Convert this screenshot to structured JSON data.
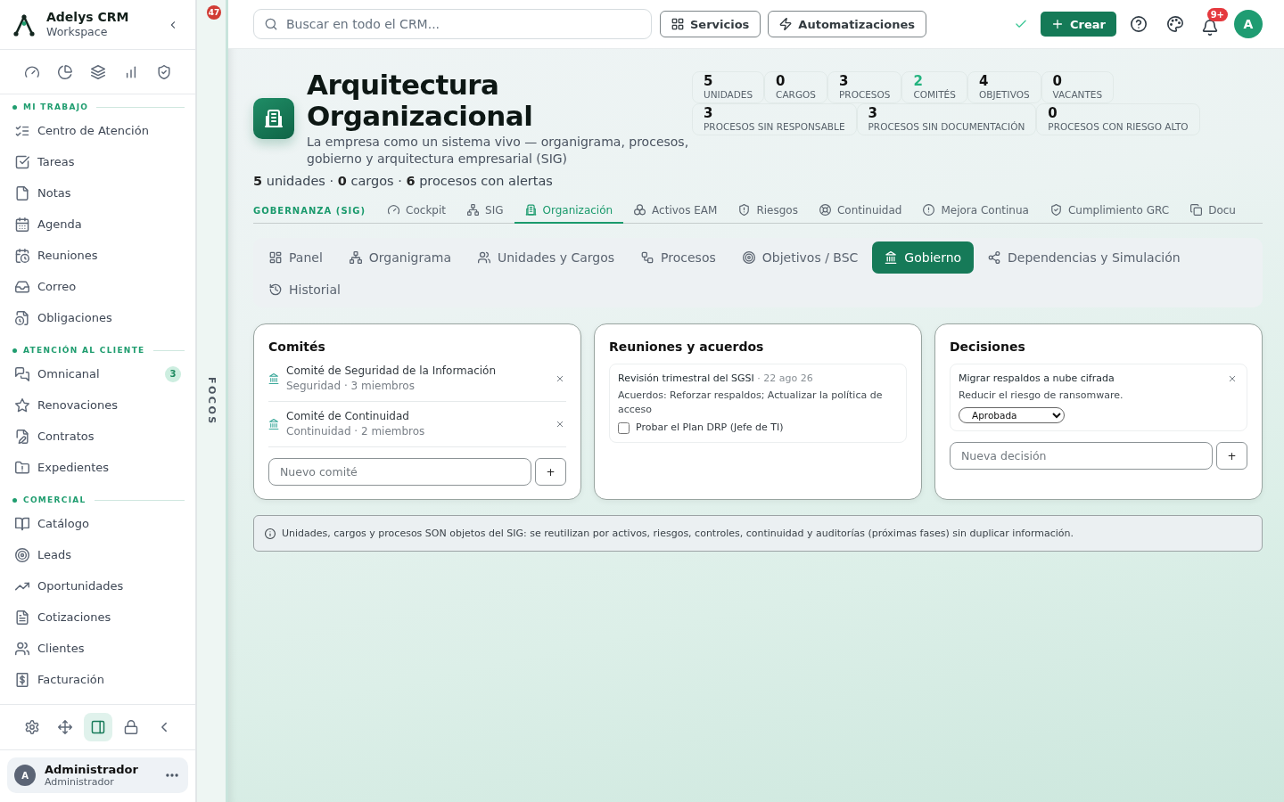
{
  "sidebar": {
    "brand": {
      "name": "Adelys CRM",
      "subtitle": "Workspace"
    },
    "sections": [
      {
        "title": "MI TRABAJO",
        "items": [
          {
            "label": "Centro de Atención"
          },
          {
            "label": "Tareas"
          },
          {
            "label": "Notas"
          },
          {
            "label": "Agenda"
          },
          {
            "label": "Reuniones"
          },
          {
            "label": "Correo"
          },
          {
            "label": "Obligaciones"
          }
        ]
      },
      {
        "title": "ATENCIÓN AL CLIENTE",
        "items": [
          {
            "label": "Omnicanal",
            "badge": "3"
          },
          {
            "label": "Renovaciones"
          },
          {
            "label": "Contratos"
          },
          {
            "label": "Expedientes"
          }
        ]
      },
      {
        "title": "COMERCIAL",
        "items": [
          {
            "label": "Catálogo"
          },
          {
            "label": "Leads"
          },
          {
            "label": "Oportunidades"
          },
          {
            "label": "Cotizaciones"
          },
          {
            "label": "Clientes"
          },
          {
            "label": "Facturación"
          }
        ]
      }
    ],
    "footer_tools": [
      {
        "selected": false
      },
      {
        "selected": false
      },
      {
        "selected": true
      },
      {
        "selected": false
      },
      {
        "selected": false
      }
    ],
    "user": {
      "initial": "A",
      "name": "Administrador",
      "role": "Administrador"
    }
  },
  "focus_rail": {
    "badge": "47",
    "label": "FOCOS"
  },
  "topbar": {
    "search": {
      "placeholder": "Buscar en todo el CRM..."
    },
    "buttons": [
      "Servicios",
      "Automatizaciones"
    ],
    "create_label": "Crear",
    "notifications": "9+",
    "avatar": "A"
  },
  "header": {
    "title": "Arquitectura Organizacional",
    "description": "La empresa como un sistema vivo — organigrama, procesos, gobierno y arquitectura empresarial (SIG)",
    "summary": "**5** unidades · **0** cargos · **6** procesos con alertas",
    "stats": [
      {
        "value": "5",
        "label": "UNIDADES",
        "highlighted": false
      },
      {
        "value": "0",
        "label": "CARGOS",
        "highlighted": false
      },
      {
        "value": "3",
        "label": "PROCESOS",
        "highlighted": false
      },
      {
        "value": "2",
        "label": "COMITÉS",
        "highlighted": true
      },
      {
        "value": "4",
        "label": "OBJETIVOS",
        "highlighted": false
      },
      {
        "value": "0",
        "label": "VACANTES",
        "highlighted": false
      }
    ],
    "alert_stats": [
      {
        "value": "3",
        "label": "PROCESOS SIN RESPONSABLE",
        "highlighted": false
      },
      {
        "value": "3",
        "label": "PROCESOS SIN DOCUMENTACIÓN",
        "highlighted": false
      },
      {
        "value": "0",
        "label": "PROCESOS CON RIESGO ALTO",
        "highlighted": false
      }
    ]
  },
  "module_nav": {
    "section_label": "GOBERNANZA (SIG)",
    "tabs": [
      {
        "label": "Cockpit",
        "selected": false
      },
      {
        "label": "SIG",
        "selected": false
      },
      {
        "label": "Organización",
        "selected": true
      },
      {
        "label": "Activos EAM",
        "selected": false
      },
      {
        "label": "Riesgos",
        "selected": false
      },
      {
        "label": "Continuidad",
        "selected": false
      },
      {
        "label": "Mejora Continua",
        "selected": false
      },
      {
        "label": "Cumplimiento GRC",
        "selected": false
      },
      {
        "label": "Docu",
        "selected": false
      }
    ]
  },
  "sub_tabs": [
    {
      "label": "Panel",
      "selected": false
    },
    {
      "label": "Organigrama",
      "selected": false
    },
    {
      "label": "Unidades y Cargos",
      "selected": false
    },
    {
      "label": "Procesos",
      "selected": false
    },
    {
      "label": "Objetivos / BSC",
      "selected": false
    },
    {
      "label": "Gobierno",
      "selected": true
    },
    {
      "label": "Dependencias y Simulación",
      "selected": false
    },
    {
      "label": "Historial",
      "selected": false
    }
  ],
  "committees": {
    "title": "Comités",
    "items": [
      {
        "name": "Comité de Seguridad de la Información",
        "meta": "Seguridad · 3 miembros"
      },
      {
        "name": "Comité de Continuidad",
        "meta": "Continuidad · 2 miembros"
      }
    ],
    "new_placeholder": "Nuevo comité",
    "add_label": "+"
  },
  "meetings": {
    "title": "Reuniones y acuerdos",
    "items": [
      {
        "title": "Revisión trimestral del SGSI",
        "date": "· 22 ago 26",
        "agreements": "Acuerdos: Reforzar respaldos; Actualizar la política de acceso",
        "tasks": [
          {
            "label": "Probar el Plan DRP (Jefe de TI)",
            "checked": false
          }
        ]
      }
    ]
  },
  "decisions": {
    "title": "Decisiones",
    "items": [
      {
        "title": "Migrar respaldos a nube cifrada",
        "rationale": "Reducir el riesgo de ransomware.",
        "status": "Aprobada"
      }
    ],
    "new_placeholder": "Nueva decisión",
    "add_label": "+"
  },
  "info_note": "Unidades, cargos y procesos SON objetos del SIG: se reutilizan por activos, riesgos, controles, continuidad y auditorías (próximas fases) sin duplicar información."
}
